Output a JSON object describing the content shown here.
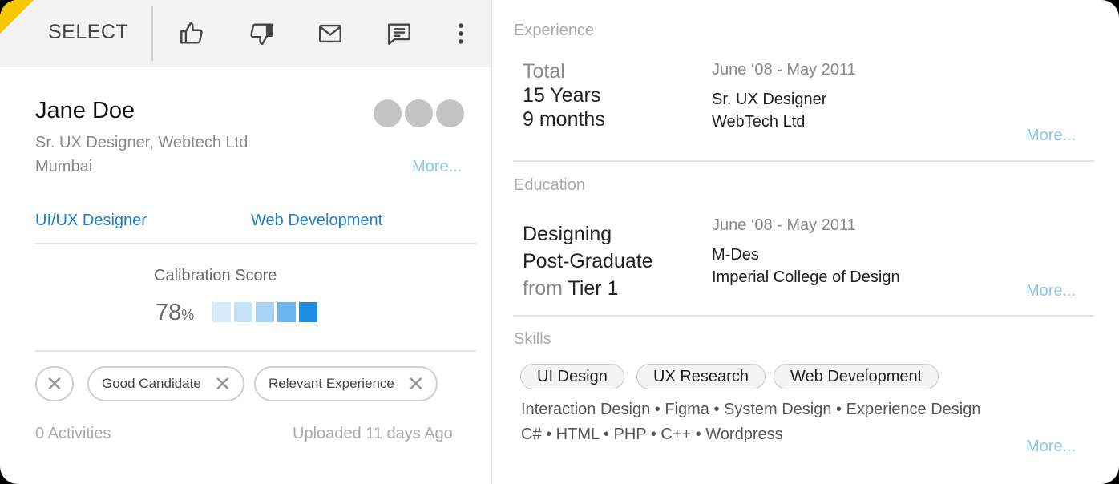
{
  "toolbar": {
    "select_label": "SELECT",
    "icons": [
      "thumbs-up-icon",
      "thumbs-down-icon",
      "mail-icon",
      "comment-icon",
      "more-vertical-icon"
    ]
  },
  "candidate": {
    "name": "Jane Doe",
    "role": "Sr. UX Designer, Webtech Ltd",
    "city": "Mumbai",
    "more": "More...",
    "tags": [
      "UI/UX Designer",
      "Web Development"
    ]
  },
  "calibration": {
    "label": "Calibration Score",
    "value": "78",
    "unit": "%",
    "bar_colors": [
      "#d6ebfa",
      "#c6e3f8",
      "#a9d3f4",
      "#6bb5ec",
      "#1e8de0"
    ]
  },
  "chips": [
    "Good Candidate",
    "Relevant Experience"
  ],
  "footer": {
    "activities": "0 Activities",
    "uploaded": "Uploaded 11 days Ago"
  },
  "experience": {
    "title": "Experience",
    "total_label": "Total",
    "years": "15 Years",
    "months": "9 months",
    "dates": "June ‘08 - May 2011",
    "position": "Sr. UX Designer",
    "company": "WebTech Ltd",
    "more": "More..."
  },
  "education": {
    "title": "Education",
    "line1": "Designing",
    "line2": "Post-Graduate",
    "from_label": "from",
    "tier": "Tier 1",
    "dates": "June ‘08 - May 2011",
    "degree": "M-Des",
    "school": "Imperial College of Design",
    "more": "More..."
  },
  "skills": {
    "title": "Skills",
    "pills": [
      "UI Design",
      "UX Research",
      "Web Development"
    ],
    "line1": "Interaction Design • Figma • System Design • Experience Design",
    "line2": "C# • HTML • PHP • C++ • Wordpress",
    "more": "More..."
  },
  "colors": {
    "accent": "#1a7fc8",
    "more_link": "#8cc6e8",
    "flag": "#f7c600"
  }
}
